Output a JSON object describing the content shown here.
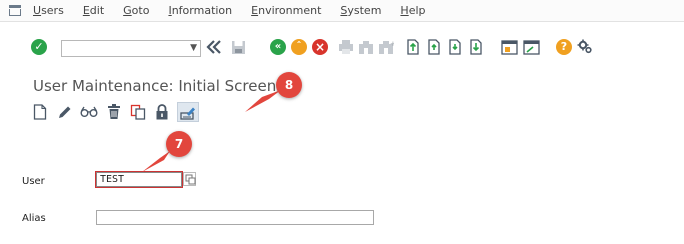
{
  "menu": {
    "items": [
      "Users",
      "Edit",
      "Goto",
      "Information",
      "Environment",
      "System",
      "Help"
    ]
  },
  "toolbar": {
    "command_field_value": "",
    "icons": [
      "enter-icon",
      "back-icon",
      "save-icon",
      "back-green-icon",
      "exit-icon",
      "cancel-icon",
      "print-icon",
      "find-icon",
      "find-next-icon",
      "first-page-icon",
      "previous-page-icon",
      "next-page-icon",
      "last-page-icon",
      "create-session-icon",
      "shortcut-icon",
      "help-icon",
      "settings-icon"
    ]
  },
  "screen": {
    "title": "User Maintenance: Initial Screen"
  },
  "app_toolbar": {
    "icons": [
      "create-icon",
      "change-icon",
      "display-icon",
      "delete-icon",
      "copy-icon",
      "lock-icon",
      "change-password-icon"
    ]
  },
  "form": {
    "user_label": "User",
    "user_value": "TEST",
    "alias_label": "Alias",
    "alias_value": ""
  },
  "annotations": {
    "step_8": "8",
    "step_7": "7"
  },
  "colors": {
    "badge": "#e2463d",
    "enter_green": "#2aa34a",
    "back_green": "#2aa34a",
    "exit_orange": "#f0a020",
    "cancel_red": "#d8342c",
    "help_orange": "#f0a020"
  }
}
